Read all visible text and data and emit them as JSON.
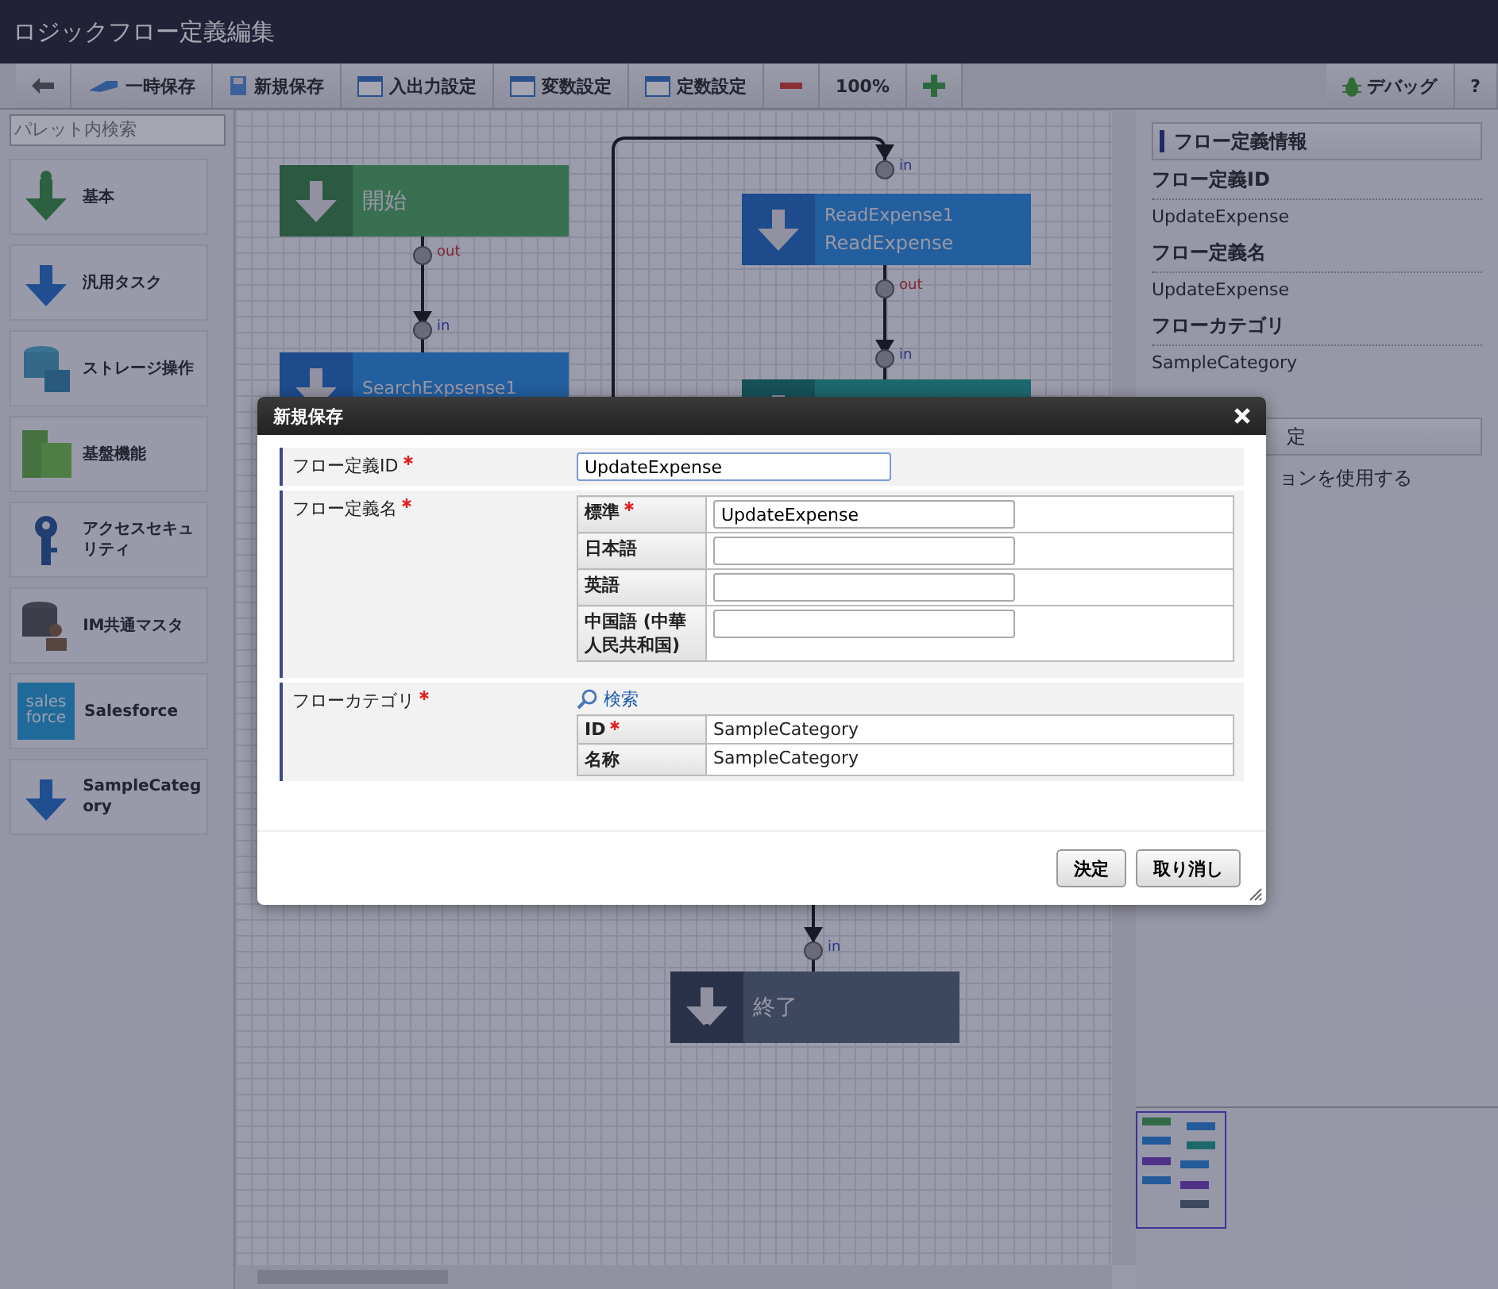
{
  "window": {
    "title": "ロジックフロー定義編集"
  },
  "toolbar": {
    "buttons": [
      {
        "kind": "back"
      },
      {
        "kind": "save-temp",
        "label": "一時保存"
      },
      {
        "kind": "save-new",
        "label": "新規保存"
      },
      {
        "kind": "window",
        "label": "入出力設定"
      },
      {
        "kind": "window",
        "label": "変数設定"
      },
      {
        "kind": "window",
        "label": "定数設定"
      },
      {
        "kind": "zoom-out"
      },
      {
        "kind": "text",
        "label": "100%"
      },
      {
        "kind": "zoom-in"
      }
    ],
    "right_buttons": [
      {
        "kind": "debug",
        "label": "デバッグ"
      },
      {
        "kind": "text",
        "label": "?"
      }
    ]
  },
  "palette": {
    "search": {
      "placeholder": "パレット内検索"
    },
    "items": [
      {
        "kind": "arrow-green",
        "label": "基本"
      },
      {
        "kind": "arrow-blue",
        "label": "汎用タスク"
      },
      {
        "kind": "database",
        "label": "ストレージ操作"
      },
      {
        "kind": "grid",
        "label": "基盤機能"
      },
      {
        "kind": "key",
        "label": "アクセスセキュリティ"
      },
      {
        "kind": "database-person",
        "label": "IM共通マスタ"
      },
      {
        "kind": "logo",
        "label": "Salesforce",
        "logo_text": [
          "sales",
          "force"
        ]
      },
      {
        "kind": "arrow-blue",
        "label": "SampleCategory"
      }
    ]
  },
  "canvas": {
    "nodes": [
      {
        "kind": "start",
        "title": "開始"
      },
      {
        "kind": "task",
        "title": "SearchExpsense1"
      },
      {
        "kind": "task",
        "title": "ReadExpense1",
        "subtitle": "ReadExpense"
      },
      {
        "kind": "branch"
      },
      {
        "kind": "end",
        "title": "終了"
      }
    ],
    "ports": [
      {
        "kind": "out",
        "label": "out"
      },
      {
        "kind": "in",
        "label": "in"
      },
      {
        "kind": "in",
        "label": "in"
      },
      {
        "kind": "out",
        "label": "out"
      },
      {
        "kind": "in",
        "label": "in"
      },
      {
        "kind": "in",
        "label": "in"
      }
    ]
  },
  "info_panel": {
    "header": "フロー定義情報",
    "fields": [
      {
        "label": "フロー定義ID",
        "value": "UpdateExpense"
      },
      {
        "label": "フロー定義名",
        "value": "UpdateExpense"
      },
      {
        "label": "フローカテゴリ",
        "value": "SampleCategory"
      }
    ],
    "section_header": "定",
    "section_text": "ョンを使用する"
  },
  "dialog": {
    "title": "新規保存",
    "id_row": {
      "label": "フロー定義ID",
      "required": true,
      "value": "UpdateExpense"
    },
    "name_row": {
      "label": "フロー定義名",
      "required": true,
      "entries": [
        {
          "label": "標準",
          "required": true,
          "value": "UpdateExpense"
        },
        {
          "label": "日本語",
          "required": false
        },
        {
          "label": "英語",
          "required": false
        },
        {
          "label": "中国語 (中華人民共和国)",
          "required": false
        }
      ]
    },
    "category_row": {
      "label": "フローカテゴリ",
      "required": true,
      "search_link": "検索",
      "entries": [
        {
          "label": "ID",
          "required": true,
          "value": "SampleCategory"
        },
        {
          "label": "名称",
          "required": false,
          "value": "SampleCategory"
        }
      ]
    },
    "buttons": [
      {
        "label": "決定"
      },
      {
        "label": "取り消し"
      }
    ]
  }
}
